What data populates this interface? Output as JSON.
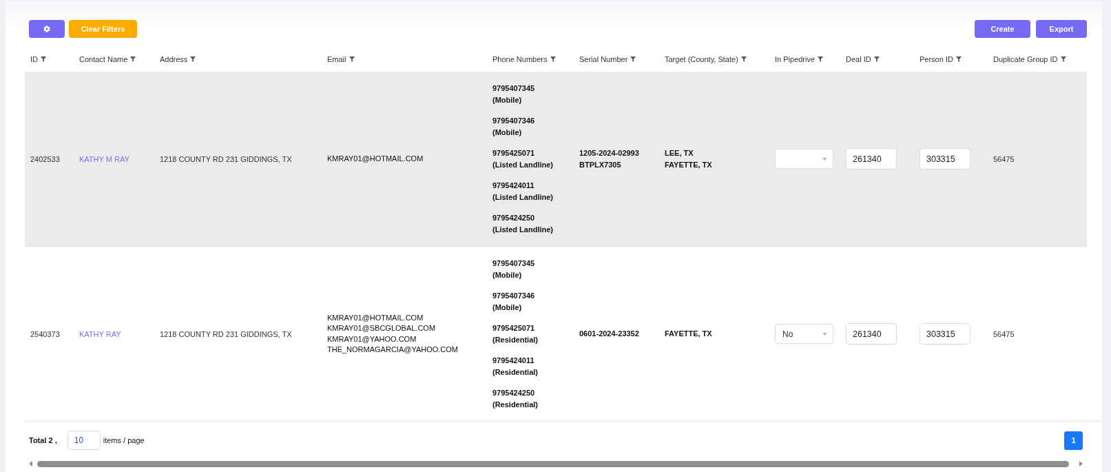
{
  "toolbar": {
    "clear_filters_label": "Clear Filters",
    "actions": [
      "Create",
      "Export"
    ]
  },
  "table": {
    "columns": [
      "ID",
      "Contact Name",
      "Address",
      "Email",
      "Phone Numbers",
      "Serial Number",
      "Target (County, State)",
      "In Pipedrive",
      "Deal ID",
      "Person ID",
      "Duplicate Group ID"
    ],
    "rows": [
      {
        "selected": true,
        "id": "2402533",
        "contact_name": "KATHY M RAY",
        "address": "1218 COUNTY RD 231 GIDDINGS, TX",
        "emails": [
          "KMRAY01@HOTMAIL.COM"
        ],
        "phones": [
          {
            "number": "9795407345",
            "type": "(Mobile)"
          },
          {
            "number": "9795407346",
            "type": "(Mobile)"
          },
          {
            "number": "9795425071",
            "type": "(Listed Landline)"
          },
          {
            "number": "9795424011",
            "type": "(Listed Landline)"
          },
          {
            "number": "9795424250",
            "type": "(Listed Landline)"
          }
        ],
        "serial_numbers": [
          "1205-2024-02993",
          "BTPLX7305"
        ],
        "targets": [
          "LEE, TX",
          "FAYETTE, TX"
        ],
        "deal_id": "261340",
        "person_id": "303315",
        "duplicate_group_id": "56475"
      },
      {
        "selected": false,
        "id": "2540373",
        "contact_name": "KATHY RAY",
        "address": "1218 COUNTY RD 231 GIDDINGS, TX",
        "emails": [
          "KMRAY01@HOTMAIL.COM",
          "KMRAY01@SBCGLOBAL.COM",
          "KMRAY01@YAHOO.COM",
          "THE_NORMAGARCIA@YAHOO.COM"
        ],
        "phones": [
          {
            "number": "9795407345",
            "type": "(Mobile)"
          },
          {
            "number": "9795407346",
            "type": "(Mobile)"
          },
          {
            "number": "9795425071",
            "type": "(Residential)"
          },
          {
            "number": "9795424011",
            "type": "(Residential)"
          },
          {
            "number": "9795424250",
            "type": "(Residential)"
          }
        ],
        "serial_numbers": [
          "0601-2024-23352"
        ],
        "targets": [
          "FAYETTE, TX"
        ],
        "in_pipedrive": "No",
        "deal_id": "261340",
        "person_id": "303315",
        "duplicate_group_id": "56475"
      }
    ]
  },
  "footer": {
    "total": "Total 2 ,",
    "page_size": "10",
    "page_size_label": "items / page",
    "pages": [
      {
        "label": "1",
        "selected": true
      }
    ]
  }
}
